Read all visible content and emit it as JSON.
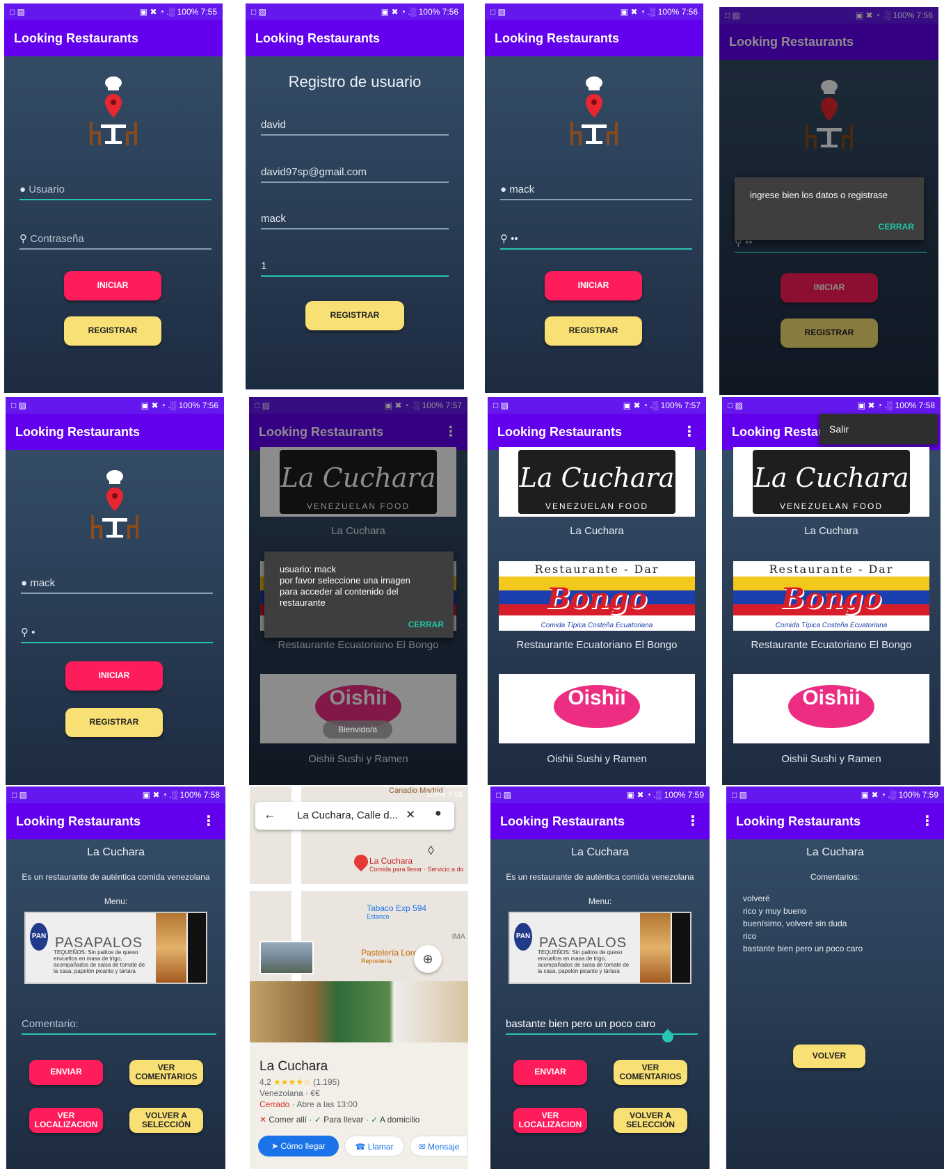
{
  "statusbar": {
    "left_icons": "□ ▨",
    "indicators": "▣ ✖ ◔ .░",
    "battery": "100%"
  },
  "app": {
    "title": "Looking Restaurants",
    "title_truncated": "Looking Restaur",
    "menu_icon": "⋮"
  },
  "panel1": {
    "time": "7:55",
    "user_placeholder": "Usuario",
    "pass_placeholder": "Contraseña",
    "login_button": "INICIAR",
    "register_button": "REGISTRAR"
  },
  "panel2": {
    "time": "7:56",
    "heading": "Registro de usuario",
    "name_value": "david",
    "email_value": "david97sp@gmail.com",
    "username_value": "mack",
    "password_value": "1",
    "register_button": "REGISTRAR"
  },
  "panel3": {
    "time": "7:56",
    "user_value": "mack",
    "pass_value": "••",
    "login_button": "INICIAR",
    "register_button": "REGISTRAR"
  },
  "panel4": {
    "time": "7:56",
    "dialog_text": "ingrese bien los datos o registrase",
    "dialog_button": "CERRAR",
    "pass_value": "••",
    "login_button": "INICIAR",
    "register_button": "REGISTRAR"
  },
  "panel5": {
    "time": "7:56",
    "user_value": "mack",
    "pass_value": "•",
    "login_button": "INICIAR",
    "register_button": "REGISTRAR"
  },
  "panel6": {
    "time": "7:57",
    "dialog_text": "usuario: mack\n por favor seleccione una imagen\npara acceder  al contenido del\nrestaurante",
    "dialog_button": "CERRAR",
    "toast": "Bienvido/a"
  },
  "panel7": {
    "time": "7:57"
  },
  "panel8": {
    "time": "7:58",
    "menu_item": "Salir"
  },
  "restaurants": [
    {
      "name": "La Cuchara",
      "logo_text": "La Cuchara",
      "logo_sub": "VENEZUELAN FOOD"
    },
    {
      "name": "Restaurante Ecuatoriano El Bongo",
      "logo_top": "Restaurante - Dar",
      "logo_text": "Bongo",
      "logo_sub": "Comida Típica Costeña Ecuatoriana"
    },
    {
      "name": "Oishii Sushi y Ramen",
      "logo_text": "Oishii"
    }
  ],
  "panel9": {
    "time": "7:58",
    "name": "La Cuchara",
    "description": "Es un restaurante de auténtica comida venezolana",
    "menu_label": "Menu:",
    "menu_logo": "PAN",
    "menu_title": "PASAPALOS",
    "menu_line": "TEQUEÑOS: Sin palitos de queso envueltos en masa de trigo, acompañados de salsa de tomate de la casa, papelón picante y tártara",
    "comment_placeholder": "Comentario:",
    "send_button": "ENVIAR",
    "view_comments_button": "VER COMENTARIOS",
    "location_button": "VER LOCALIZACION",
    "back_button": "VOLVER A SELECCIÓN"
  },
  "panel10": {
    "time": "7:58",
    "search_text": "La Cuchara, Calle d...",
    "top_label": "Canadio Madrid",
    "pin_title": "La Cuchara",
    "pin_sub": "Comida para llevar · Servicio a do",
    "poi1": "Tabaco Exp 594",
    "poi1_sub": "Estanco",
    "poi2": "Pastelería Lorena",
    "poi2_sub": "Repostería",
    "edge_label": "IMA",
    "place_name": "La Cuchara",
    "rating": "4,2",
    "stars": "★★★★☆",
    "reviews": "(1.195)",
    "category": "Venezolana · €€",
    "status": "Cerrado",
    "hours": "· Abre a las 13:00",
    "opt1": "Comer allí",
    "opt2": "Para llevar",
    "opt3": "A domicilio",
    "directions": "Cómo llegar",
    "call": "Llamar",
    "message": "Mensaje"
  },
  "panel11": {
    "time": "7:59",
    "name": "La Cuchara",
    "description": "Es un restaurante de auténtica comida venezolana",
    "menu_label": "Menu:",
    "menu_logo": "PAN",
    "menu_title": "PASAPALOS",
    "menu_line": "TEQUEÑOS: Sin palitos de queso envueltos en masa de trigo, acompañados de salsa de tomate de la casa, papelón picante y tártara",
    "comment_value": "bastante  bien  pero un poco caro",
    "send_button": "ENVIAR",
    "view_comments_button": "VER COMENTARIOS",
    "location_button": "VER LOCALIZACION",
    "back_button": "VOLVER A SELECCIÓN"
  },
  "panel12": {
    "time": "7:59",
    "name": "La Cuchara",
    "comments_label": "Comentarios:",
    "comments": [
      "volveré",
      "rico y muy bueno",
      "buenísimo, volveré sin duda",
      "rico",
      "bastante  bien  pero un poco caro"
    ],
    "back_button": "VOLVER"
  },
  "colors": {
    "appbar": "#6200ee",
    "primary_button": "#ff1c5a",
    "secondary_button": "#f8e075",
    "accent": "#27c4b4"
  }
}
